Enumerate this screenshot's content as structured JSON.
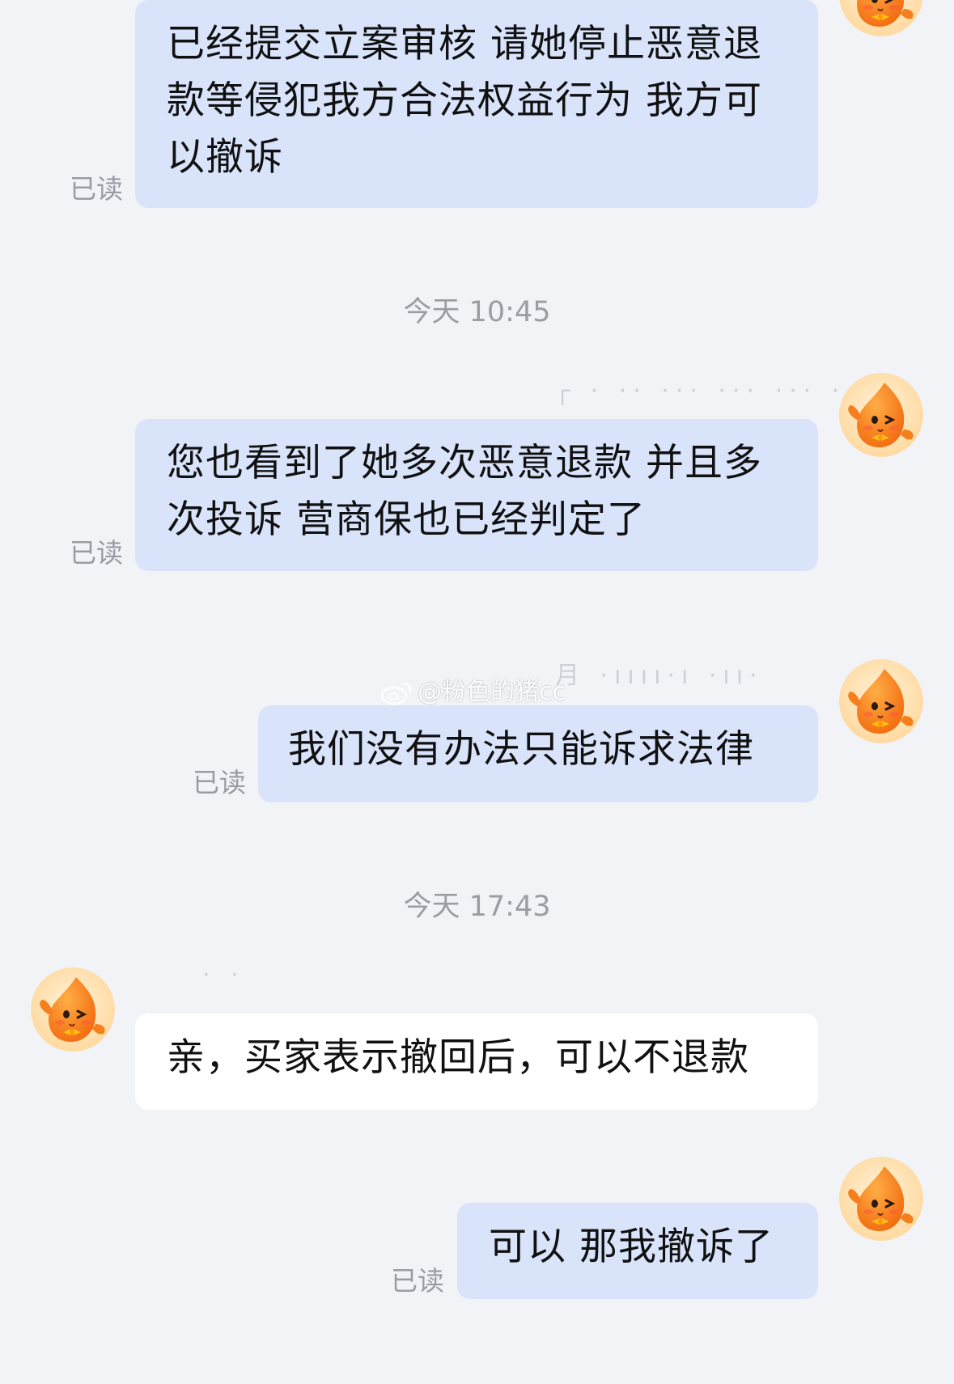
{
  "messages": [
    {
      "text": "已经提交立案审核 请她停止恶意退款等侵犯我方合法权益行为 我方可以撤诉",
      "read": "已读"
    },
    {
      "text": "您也看到了她多次恶意退款 并且多次投诉 营商保也已经判定了",
      "read": "已读"
    },
    {
      "text": "我们没有办法只能诉求法律",
      "read": "已读"
    },
    {
      "text": "亲，买家表示撤回后，可以不退款"
    },
    {
      "text": "可以 那我撤诉了",
      "read": "已读"
    }
  ],
  "timestamps": [
    "今天 10:45",
    "今天 17:43"
  ],
  "watermark": "@粉色的猪cc",
  "colors": {
    "background": "#f2f3f7",
    "outgoing_bubble": "#d9e4fb",
    "incoming_bubble": "#ffffff",
    "read_text": "#9a9ca3",
    "avatar_orange": "#f5821f"
  },
  "icons": [
    "mascot-avatar-icon",
    "weibo-logo-icon"
  ]
}
